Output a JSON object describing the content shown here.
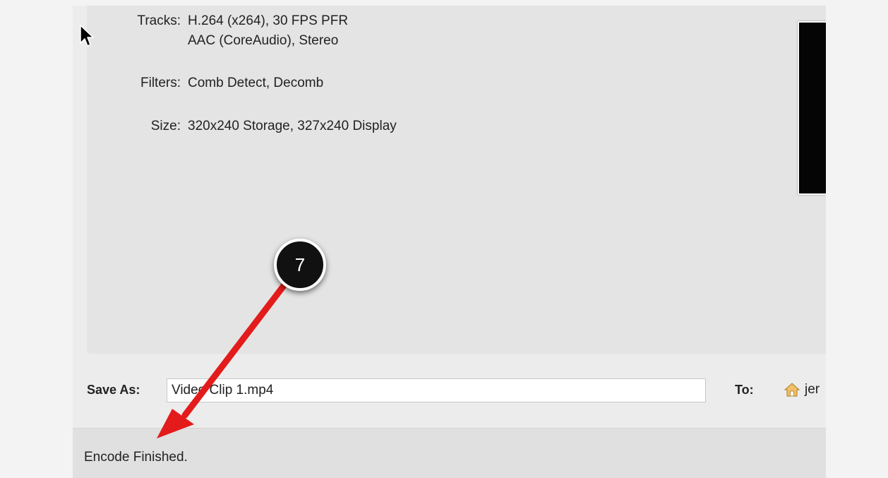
{
  "summary": {
    "tracks_label": "Tracks:",
    "tracks_video": "H.264 (x264), 30 FPS PFR",
    "tracks_audio": "AAC (CoreAudio), Stereo",
    "filters_label": "Filters:",
    "filters_value": "Comb Detect, Decomb",
    "size_label": "Size:",
    "size_value": "320x240 Storage, 327x240 Display"
  },
  "save": {
    "label": "Save As:",
    "value": "Video Clip 1.mp4",
    "to_label": "To:",
    "destination": "jer",
    "destination_icon": "home-folder-icon"
  },
  "status": {
    "text": "Encode Finished."
  },
  "annotation": {
    "step_number": "7",
    "arrow_color": "#e31b1b"
  }
}
